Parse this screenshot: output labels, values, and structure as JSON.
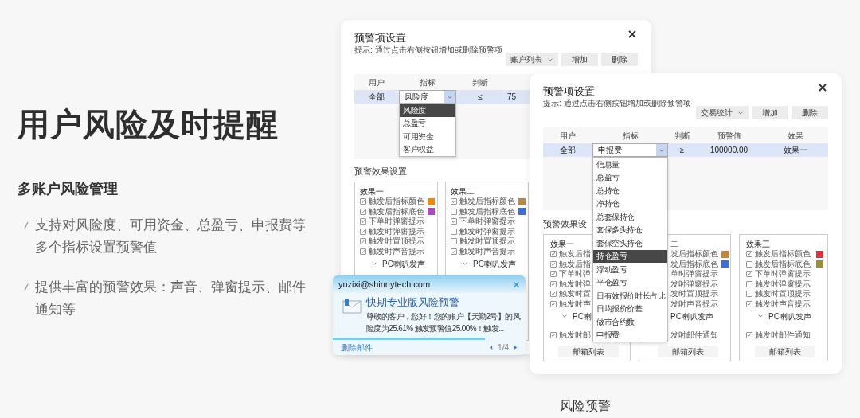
{
  "headline": "用户风险及时提醒",
  "subheading": "多账户风险管理",
  "bullets": [
    "支持对风险度、可用资金、总盈亏、申报费等多个指标设置预警值",
    "提供丰富的预警效果：声音、弹窗提示、邮件通知等"
  ],
  "windows": [
    {
      "title": "预警项设置",
      "hint": "提示: 通过点击右侧按钮增加或删除预警项",
      "toolbar": {
        "dropdown": "账户列表",
        "buttons": [
          "增加",
          "删除"
        ]
      },
      "table": {
        "columns": [
          "用户",
          "指标",
          "判断"
        ],
        "rows": [
          {
            "user": "全部",
            "indicator": "风险度",
            "comparison": "≤",
            "value": "75"
          }
        ]
      },
      "indicator_options": [
        {
          "label": "风险度",
          "selected": true
        },
        {
          "label": "总盈亏",
          "selected": false
        },
        {
          "label": "可用资金",
          "selected": false
        },
        {
          "label": "客户权益",
          "selected": false
        }
      ],
      "effects_heading": "预警效果设置",
      "effects": [
        {
          "title": "效果一",
          "options": [
            {
              "label": "触发后指标颜色",
              "checked": true,
              "color": "#f08a00"
            },
            {
              "label": "触发后指标底色",
              "checked": true,
              "color": "#b845c8"
            },
            {
              "label": "下单时弹窗提示",
              "checked": true
            },
            {
              "label": "触发时弹窗提示",
              "checked": true
            },
            {
              "label": "触发时置顶提示",
              "checked": true
            },
            {
              "label": "触发时声音提示",
              "checked": true
            }
          ],
          "sound": "PC喇叭发声"
        },
        {
          "title": "效果二",
          "options": [
            {
              "label": "触发后指标颜色",
              "checked": true,
              "color": "#c0873a"
            },
            {
              "label": "触发后指标底色",
              "checked": false,
              "color": "#3d6ee0"
            },
            {
              "label": "下单时弹窗提示",
              "checked": true
            },
            {
              "label": "触发时弹窗提示",
              "checked": false
            },
            {
              "label": "触发时置顶提示",
              "checked": false
            },
            {
              "label": "触发时声音提示",
              "checked": true
            }
          ],
          "sound": "PC喇叭发声"
        }
      ]
    },
    {
      "title": "预警项设置",
      "hint": "提示: 通过点击右侧按钮增加或删除预警项",
      "toolbar": {
        "dropdown": "交易统计",
        "buttons": [
          "增加",
          "删除"
        ]
      },
      "table": {
        "columns": [
          "用户",
          "指标",
          "判断",
          "预警值",
          "效果"
        ],
        "rows": [
          {
            "user": "全部",
            "indicator": "申报费",
            "comparison": "≥",
            "value": "100000.00",
            "effect": "效果一"
          }
        ]
      },
      "indicator_options": [
        {
          "label": "信息量",
          "selected": false
        },
        {
          "label": "总盈亏",
          "selected": false
        },
        {
          "label": "总持仓",
          "selected": false
        },
        {
          "label": "净持仓",
          "selected": false
        },
        {
          "label": "总套保持仓",
          "selected": false
        },
        {
          "label": "套保多头持仓",
          "selected": false
        },
        {
          "label": "套保空头持仓",
          "selected": false
        },
        {
          "label": "持仓盈亏",
          "selected": true
        },
        {
          "label": "浮动盈亏",
          "selected": false
        },
        {
          "label": "平仓盈亏",
          "selected": false
        },
        {
          "label": "日有效报价时长占比",
          "selected": false
        },
        {
          "label": "日均报价价差",
          "selected": false
        },
        {
          "label": "做市合约数",
          "selected": false
        },
        {
          "label": "申报费",
          "selected": false
        }
      ],
      "effects_heading": "预警效果设",
      "effects": [
        {
          "title": "效果一",
          "options": [
            {
              "label": "触发后指",
              "checked": true
            },
            {
              "label": "触发后指",
              "checked": true
            },
            {
              "label": "下单时弹",
              "checked": true
            },
            {
              "label": "触发时弹",
              "checked": true
            },
            {
              "label": "触发时置",
              "checked": true
            },
            {
              "label": "触发时声",
              "checked": true
            }
          ],
          "sound": "PC喇",
          "email": {
            "label": "触发时邮",
            "checked": true
          },
          "mailbox_button": "邮箱列表"
        },
        {
          "title": "二",
          "options": [
            {
              "label": "发后指标颜色",
              "color": "#c0873a"
            },
            {
              "label": "发后指标底色",
              "color": "#3d6ee0"
            },
            {
              "label": "单时弹窗提示"
            },
            {
              "label": "发时弹窗提示"
            },
            {
              "label": "发时置顶提示"
            },
            {
              "label": "发时声音提示"
            }
          ],
          "sound": "PC喇叭发声",
          "email": {
            "label": "发时邮件通知"
          },
          "mailbox_button": "邮箱列表"
        },
        {
          "title": "效果三",
          "options": [
            {
              "label": "触发后指标颜色",
              "checked": true,
              "color": "#e0303a"
            },
            {
              "label": "触发后指标底色",
              "checked": false,
              "color": "#9a9030"
            },
            {
              "label": "下单时弹窗提示",
              "checked": true
            },
            {
              "label": "触发时弹窗提示",
              "checked": false
            },
            {
              "label": "触发时置顶提示",
              "checked": false
            },
            {
              "label": "触发时声音提示",
              "checked": true
            }
          ],
          "sound": "PC喇叭发声",
          "email": {
            "label": "触发时邮件通知",
            "checked": true
          },
          "mailbox_button": "邮箱列表"
        }
      ]
    }
  ],
  "notification": {
    "sender": "yuzixi@shinnytech.com",
    "title": "快期专业版风险预警",
    "body": "尊敬的客户，您好！您的账户【天勤2号】的风险度为25.61% 触发预警值25.00%！触发...",
    "level": 0.79,
    "delete_link": "删除邮件",
    "pager": "1/4"
  },
  "caption": "风险预警"
}
